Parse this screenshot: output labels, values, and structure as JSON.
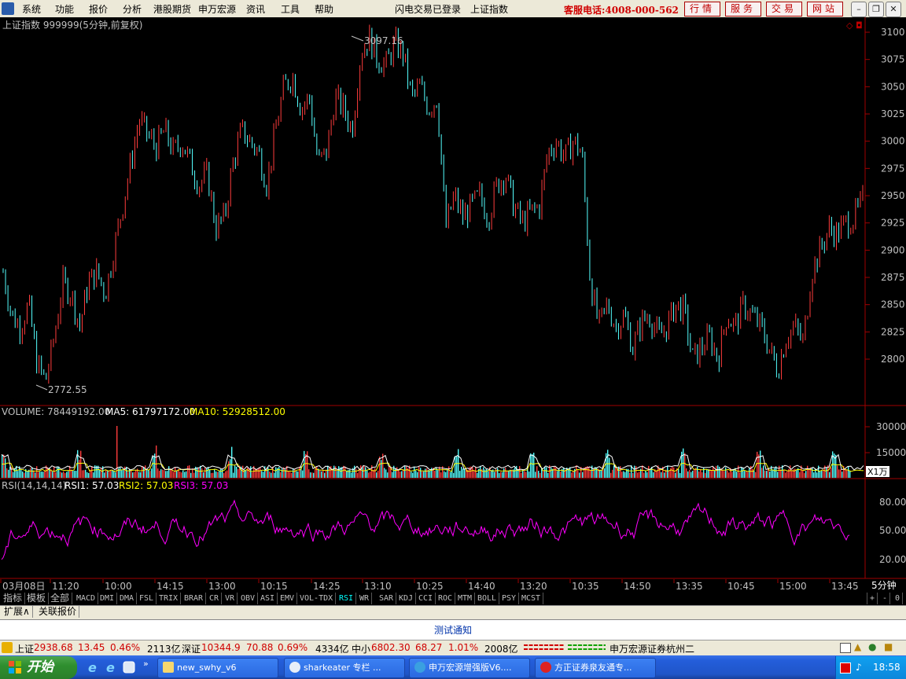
{
  "menu": {
    "items": [
      "系统",
      "功能",
      "报价",
      "分析",
      "港股期货",
      "申万宏源",
      "资讯",
      "工具",
      "帮助"
    ],
    "login_status": "闪电交易已登录",
    "current_symbol": "上证指数",
    "service_phone": "客服电话:4008-000-562",
    "top_buttons": [
      "行情",
      "服务",
      "交易",
      "网站"
    ]
  },
  "chart": {
    "title": "上证指数 999999(5分钟,前复权)",
    "high_label": "3097.16",
    "low_label": "2772.55",
    "price_axis": [
      "3100",
      "3075",
      "3050",
      "3025",
      "3000",
      "2975",
      "2950",
      "2925",
      "2900",
      "2875",
      "2850",
      "2825",
      "2800"
    ],
    "volume": {
      "label": "VOLUME: 78449192.00",
      "ma5": "MA5: 61797172.00",
      "ma10": "MA10: 52928512.00",
      "axis": [
        "30000",
        "15000"
      ],
      "unit": "X1万"
    },
    "rsi": {
      "label": "RSI(14,14,14)",
      "rsi1": "RSI1: 57.03",
      "rsi2": "RSI2: 57.03",
      "rsi3": "RSI3: 57.03",
      "axis": [
        "80.00",
        "50.00",
        "20.00"
      ]
    },
    "time_axis": [
      "03月08日",
      "11:20",
      "10:00",
      "14:15",
      "13:00",
      "10:15",
      "14:25",
      "13:10",
      "10:25",
      "14:40",
      "13:20",
      "10:35",
      "14:50",
      "13:35",
      "10:45",
      "15:00",
      "13:45"
    ],
    "period": "5分钟",
    "colors": {
      "up": "#ff3c3c",
      "down": "#54ffff",
      "border": "#a00000",
      "rsi": "#ff00ff",
      "ma5": "#ffffff",
      "ma10": "#ffff00"
    }
  },
  "chart_data": {
    "type": "candlestick",
    "title": "上证指数 999999(5分钟,前复权)",
    "ylim": [
      2770,
      3100
    ],
    "high": 3097.16,
    "low": 2772.55,
    "close_path": [
      2880,
      2840,
      2830,
      2850,
      2795,
      2780,
      2820,
      2870,
      2860,
      2830,
      2870,
      2880,
      2860,
      2900,
      2940,
      2980,
      3020,
      3005,
      2995,
      3010,
      2990,
      3000,
      2980,
      2960,
      2970,
      2920,
      2930,
      2980,
      3010,
      3000,
      2990,
      2960,
      3010,
      3050,
      3060,
      3030,
      3040,
      2980,
      2990,
      3040,
      3030,
      3010,
      3080,
      3095,
      3075,
      3070,
      3090,
      3080,
      3040,
      3050,
      3030,
      3040,
      2920,
      2950,
      2930,
      2940,
      2950,
      2930,
      2960,
      2970,
      2940,
      2925,
      2935,
      2940,
      2990,
      3000,
      2985,
      3000,
      2990,
      2870,
      2830,
      2850,
      2830,
      2840,
      2810,
      2835,
      2840,
      2820,
      2830,
      2850,
      2845,
      2800,
      2810,
      2820,
      2800,
      2840,
      2830,
      2850,
      2840,
      2830,
      2810,
      2790,
      2820,
      2830,
      2815,
      2880,
      2900,
      2920,
      2915,
      2925,
      2930,
      2945
    ],
    "volume": {
      "axis_ticks": [
        30000,
        15000
      ],
      "unit": "万",
      "last": 78449192.0,
      "ma5": 61797172.0,
      "ma10": 52928512.0
    },
    "rsi": {
      "axis_ticks": [
        80,
        50,
        20
      ],
      "rsi1": 57.03,
      "rsi2": 57.03,
      "rsi3": 57.03
    }
  },
  "indicators": [
    "指标",
    "模板",
    "全部",
    "MACD",
    "DMI",
    "DMA",
    "FSL",
    "TRIX",
    "BRAR",
    "CR",
    "VR",
    "OBV",
    "ASI",
    "EMV",
    "VOL-TDX",
    "RSI",
    "WR",
    "SAR",
    "KDJ",
    "CCI",
    "ROC",
    "MTM",
    "BOLL",
    "PSY",
    "MCST"
  ],
  "active_indicator": "RSI",
  "ext_tabs": [
    "扩展∧",
    "关联报价"
  ],
  "scroll_controls": [
    "+",
    "-",
    "0"
  ],
  "notice": "测试通知",
  "status": {
    "sh_label": "上证",
    "sh_value": "2938.68",
    "sh_change": "13.45",
    "sh_pct": "0.46%",
    "sh_amount": "2113亿",
    "sz_label": "深证",
    "sz_value": "10344.9",
    "sz_change": "70.88",
    "sz_pct": "0.69%",
    "sz_amount": "4334亿",
    "zx_label": "中小",
    "zx_value": "6802.30",
    "zx_change": "68.27",
    "zx_pct": "1.01%",
    "zx_amount": "2008亿",
    "broker": "申万宏源证券杭州二"
  },
  "taskbar": {
    "start": "开始",
    "tasks": [
      "new_swhy_v6",
      "sharkeater 专栏 ...",
      "申万宏源增强版V6....",
      "方正证券泉友通专..."
    ],
    "clock": "18:58"
  }
}
